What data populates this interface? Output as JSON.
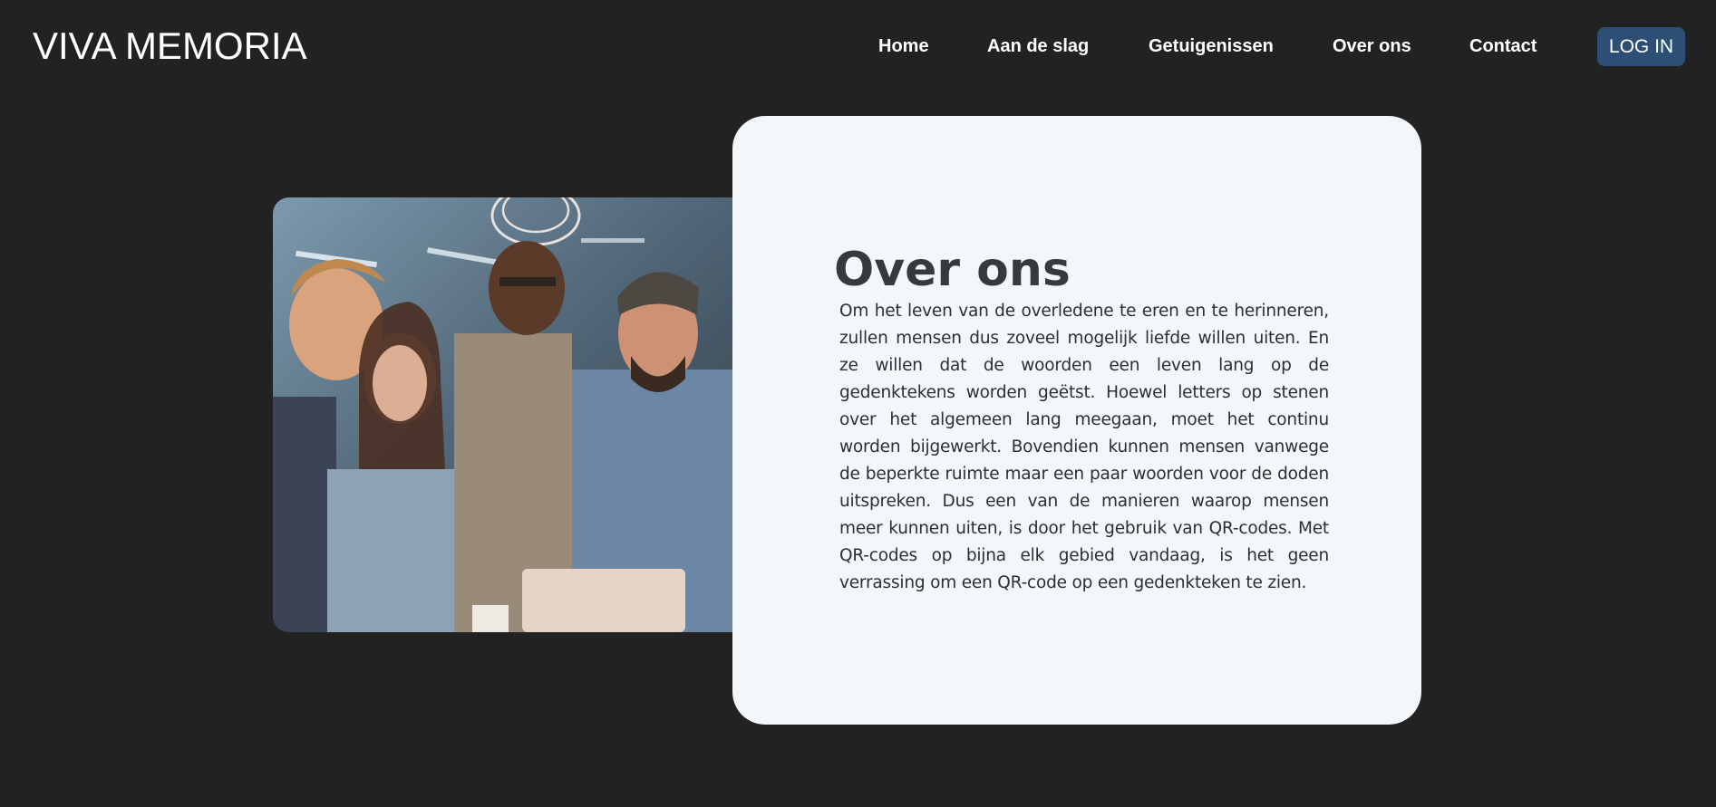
{
  "header": {
    "brand": "VIVA MEMORIA",
    "nav": [
      {
        "label": "Home"
      },
      {
        "label": "Aan de slag"
      },
      {
        "label": "Getuigenissen"
      },
      {
        "label": "Over ons"
      },
      {
        "label": "Contact"
      }
    ],
    "login_label": "LOG IN"
  },
  "about": {
    "title": "Over ons",
    "body": "Om het leven van de overledene te eren en te herinneren, zullen mensen dus zoveel mogelijk liefde willen uiten. En ze willen dat de woorden een leven lang op de gedenktekens worden geëtst. Hoewel letters op stenen over het algemeen lang meegaan, moet het continu worden bijgewerkt. Bovendien kunnen mensen vanwege de beperkte ruimte maar een paar woorden voor de doden uitspreken. Dus een van de manieren waarop mensen meer kunnen uiten, is door het gebruik van QR-codes. Met QR-codes op bijna elk gebied vandaag, is het geen verrassing om een QR-code op een gedenkteken te zien."
  },
  "colors": {
    "page_background": "#222222",
    "card_background": "#f3f7fa",
    "login_button": "#2e4f75",
    "title_text": "#343a40"
  }
}
